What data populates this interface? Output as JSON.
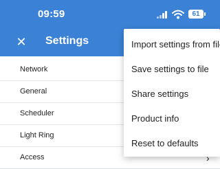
{
  "status_bar": {
    "time": "09:59",
    "battery": "61",
    "icons": [
      "signal-icon",
      "wifi-icon",
      "battery-icon"
    ]
  },
  "app_bar": {
    "close_icon": "close-icon",
    "title": "Settings",
    "background_color": "#3b82d6"
  },
  "settings_list": {
    "items": [
      {
        "label": "Network"
      },
      {
        "label": "General"
      },
      {
        "label": "Scheduler"
      },
      {
        "label": "Light Ring"
      },
      {
        "label": "Access"
      }
    ]
  },
  "overflow_menu": {
    "items": [
      {
        "label": "Import settings from file"
      },
      {
        "label": "Save settings to file"
      },
      {
        "label": "Share settings"
      },
      {
        "label": "Product info"
      },
      {
        "label": "Reset to defaults"
      }
    ]
  }
}
